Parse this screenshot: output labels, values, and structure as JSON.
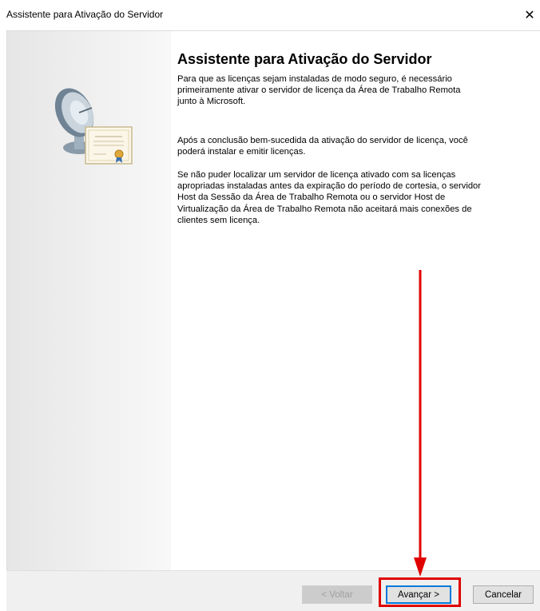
{
  "window": {
    "title": "Assistente para Ativação do Servidor",
    "close_glyph": "✕"
  },
  "wizard": {
    "heading": "Assistente para Ativação do Servidor",
    "paragraphs": [
      "Para que as licenças sejam instaladas de modo seguro, é necessário primeiramente ativar o servidor de licença da Área de Trabalho Remota junto à Microsoft.",
      "Após a conclusão bem-sucedida da ativação do servidor de licença, você poderá instalar e emitir licenças.",
      "Se não puder localizar um servidor de licença ativado com sa licenças apropriadas instaladas antes da expiração do período de cortesia, o servidor Host da Sessão da Área de Trabalho Remota ou o servidor Host de Virtualização da Área de Trabalho Remota não aceitará mais conexões de clientes sem licença."
    ],
    "illustration": "server-license-certificate-icon"
  },
  "buttons": {
    "back": "< Voltar",
    "next": "Avançar >",
    "cancel": "Cancelar"
  },
  "annotation": {
    "highlight_color": "#e00000"
  }
}
